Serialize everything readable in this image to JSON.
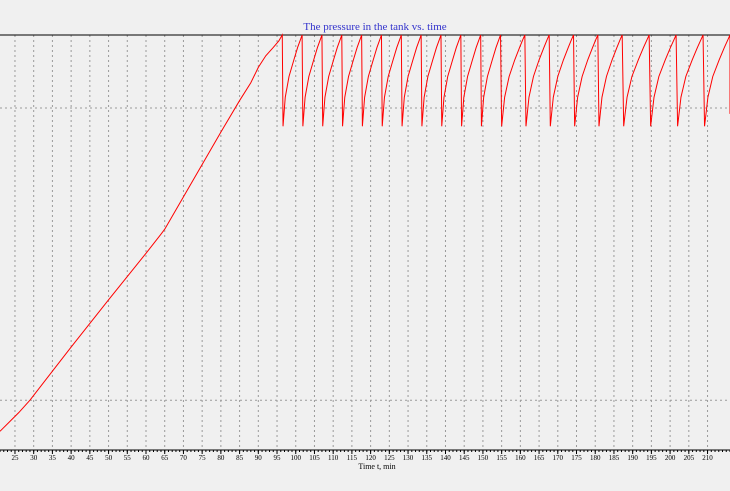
{
  "chart_data": {
    "type": "line",
    "title": "The pressure in the tank vs. time",
    "xlabel": "Time t, min",
    "ylabel": "",
    "xlim": [
      21,
      216
    ],
    "x_ticks": [
      25,
      30,
      35,
      40,
      45,
      50,
      55,
      60,
      65,
      70,
      75,
      80,
      85,
      90,
      95,
      100,
      105,
      110,
      115,
      120,
      125,
      130,
      135,
      140,
      145,
      150,
      155,
      160,
      165,
      170,
      175,
      180,
      185,
      190,
      195,
      200,
      205,
      210
    ],
    "minor_ticks_per_major": 5,
    "grid": true,
    "y_gridlines_relative": [
      0.176,
      0.88
    ],
    "colors": {
      "line": "#ff0000",
      "title": "#3333cc",
      "grid": "#9a9a9a",
      "axis": "#000000",
      "background": "#f0f0f0"
    },
    "series": [
      {
        "points_relative": [
          [
            21.0,
            0.955
          ],
          [
            26.0,
            0.91
          ],
          [
            29.0,
            0.88
          ],
          [
            35.0,
            0.81
          ],
          [
            40.0,
            0.752
          ],
          [
            45.0,
            0.695
          ],
          [
            50.0,
            0.638
          ],
          [
            55.0,
            0.582
          ],
          [
            60.0,
            0.526
          ],
          [
            64.0,
            0.48
          ],
          [
            65.0,
            0.468
          ],
          [
            70.0,
            0.39
          ],
          [
            75.0,
            0.312
          ],
          [
            80.0,
            0.234
          ],
          [
            85.0,
            0.158
          ],
          [
            88.0,
            0.115
          ],
          [
            90.0,
            0.078
          ],
          [
            92.0,
            0.05
          ],
          [
            94.0,
            0.03
          ],
          [
            95.5,
            0.014
          ],
          [
            96.4,
            0.0
          ],
          [
            96.6,
            0.22
          ],
          [
            97.2,
            0.15
          ],
          [
            98.2,
            0.1
          ],
          [
            99.5,
            0.06
          ],
          [
            100.5,
            0.03
          ],
          [
            101.3,
            0.01
          ],
          [
            101.7,
            0.0
          ],
          [
            101.9,
            0.22
          ],
          [
            102.5,
            0.15
          ],
          [
            103.5,
            0.1
          ],
          [
            104.8,
            0.06
          ],
          [
            105.8,
            0.03
          ],
          [
            106.6,
            0.01
          ],
          [
            107.0,
            0.0
          ],
          [
            107.2,
            0.22
          ],
          [
            107.8,
            0.15
          ],
          [
            108.8,
            0.1
          ],
          [
            110.1,
            0.06
          ],
          [
            111.1,
            0.03
          ],
          [
            111.9,
            0.01
          ],
          [
            112.3,
            0.0
          ],
          [
            112.5,
            0.22
          ],
          [
            113.1,
            0.15
          ],
          [
            114.1,
            0.1
          ],
          [
            115.4,
            0.06
          ],
          [
            116.4,
            0.03
          ],
          [
            117.2,
            0.01
          ],
          [
            117.6,
            0.0
          ],
          [
            117.8,
            0.22
          ],
          [
            118.4,
            0.15
          ],
          [
            119.4,
            0.1
          ],
          [
            120.7,
            0.06
          ],
          [
            121.7,
            0.03
          ],
          [
            122.5,
            0.01
          ],
          [
            122.9,
            0.0
          ],
          [
            123.1,
            0.22
          ],
          [
            123.7,
            0.15
          ],
          [
            124.7,
            0.1
          ],
          [
            126.0,
            0.06
          ],
          [
            127.0,
            0.03
          ],
          [
            127.8,
            0.01
          ],
          [
            128.2,
            0.0
          ],
          [
            128.4,
            0.22
          ],
          [
            129.0,
            0.15
          ],
          [
            130.0,
            0.1
          ],
          [
            131.3,
            0.06
          ],
          [
            132.3,
            0.03
          ],
          [
            133.1,
            0.01
          ],
          [
            133.5,
            0.0
          ],
          [
            133.7,
            0.22
          ],
          [
            134.3,
            0.15
          ],
          [
            135.3,
            0.1
          ],
          [
            136.6,
            0.06
          ],
          [
            137.6,
            0.03
          ],
          [
            138.4,
            0.01
          ],
          [
            138.8,
            0.0
          ],
          [
            139.0,
            0.22
          ],
          [
            139.6,
            0.15
          ],
          [
            140.6,
            0.1
          ],
          [
            141.9,
            0.06
          ],
          [
            142.9,
            0.03
          ],
          [
            143.7,
            0.01
          ],
          [
            144.1,
            0.0
          ],
          [
            144.3,
            0.22
          ],
          [
            144.9,
            0.15
          ],
          [
            145.9,
            0.1
          ],
          [
            147.2,
            0.06
          ],
          [
            148.2,
            0.03
          ],
          [
            149.0,
            0.01
          ],
          [
            149.4,
            0.0
          ],
          [
            149.6,
            0.22
          ],
          [
            150.2,
            0.15
          ],
          [
            151.2,
            0.1
          ],
          [
            152.5,
            0.06
          ],
          [
            153.5,
            0.03
          ],
          [
            154.3,
            0.01
          ],
          [
            154.7,
            0.0
          ],
          [
            155.0,
            0.22
          ],
          [
            155.8,
            0.15
          ],
          [
            157.0,
            0.1
          ],
          [
            158.5,
            0.06
          ],
          [
            159.8,
            0.03
          ],
          [
            160.7,
            0.01
          ],
          [
            161.2,
            0.0
          ],
          [
            161.5,
            0.22
          ],
          [
            162.3,
            0.15
          ],
          [
            163.5,
            0.1
          ],
          [
            165.0,
            0.06
          ],
          [
            166.3,
            0.03
          ],
          [
            167.2,
            0.01
          ],
          [
            167.7,
            0.0
          ],
          [
            168.0,
            0.22
          ],
          [
            168.8,
            0.15
          ],
          [
            170.0,
            0.1
          ],
          [
            171.5,
            0.06
          ],
          [
            172.8,
            0.03
          ],
          [
            173.7,
            0.01
          ],
          [
            174.2,
            0.0
          ],
          [
            174.5,
            0.22
          ],
          [
            175.3,
            0.15
          ],
          [
            176.5,
            0.1
          ],
          [
            178.0,
            0.06
          ],
          [
            179.3,
            0.03
          ],
          [
            180.2,
            0.01
          ],
          [
            180.7,
            0.0
          ],
          [
            181.0,
            0.22
          ],
          [
            181.8,
            0.15
          ],
          [
            183.0,
            0.1
          ],
          [
            184.5,
            0.06
          ],
          [
            185.8,
            0.03
          ],
          [
            186.7,
            0.01
          ],
          [
            187.2,
            0.0
          ],
          [
            187.6,
            0.22
          ],
          [
            188.5,
            0.15
          ],
          [
            189.8,
            0.1
          ],
          [
            191.5,
            0.06
          ],
          [
            192.9,
            0.03
          ],
          [
            193.9,
            0.01
          ],
          [
            194.4,
            0.0
          ],
          [
            194.8,
            0.22
          ],
          [
            195.7,
            0.15
          ],
          [
            197.0,
            0.1
          ],
          [
            198.7,
            0.06
          ],
          [
            200.1,
            0.03
          ],
          [
            201.1,
            0.01
          ],
          [
            201.6,
            0.0
          ],
          [
            202.0,
            0.22
          ],
          [
            202.9,
            0.15
          ],
          [
            204.2,
            0.1
          ],
          [
            205.9,
            0.06
          ],
          [
            207.3,
            0.03
          ],
          [
            208.3,
            0.01
          ],
          [
            208.8,
            0.0
          ],
          [
            209.2,
            0.22
          ],
          [
            210.1,
            0.15
          ],
          [
            211.4,
            0.1
          ],
          [
            213.1,
            0.06
          ],
          [
            214.5,
            0.03
          ],
          [
            215.5,
            0.01
          ],
          [
            216.0,
            0.0
          ],
          [
            216.0,
            0.19
          ]
        ]
      }
    ]
  }
}
